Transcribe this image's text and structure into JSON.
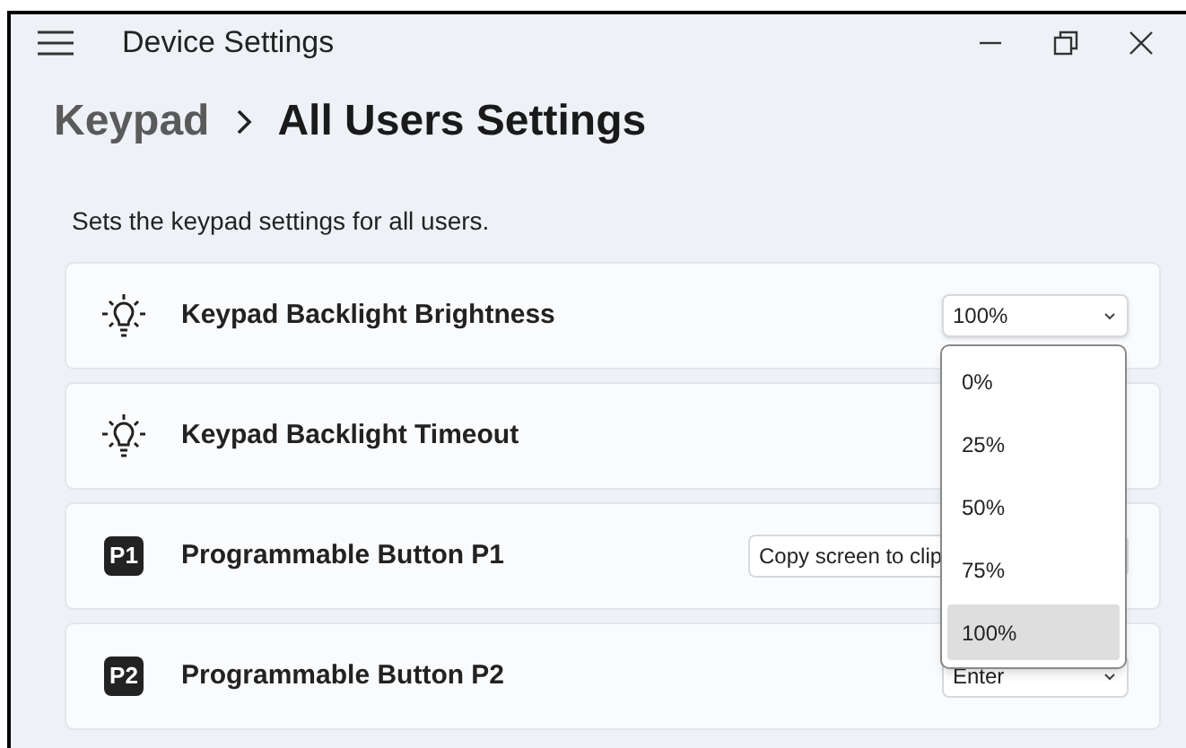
{
  "window": {
    "title": "Device Settings"
  },
  "breadcrumb": [
    {
      "label": "Keypad",
      "current": false
    },
    {
      "label": "All Users Settings",
      "current": true
    }
  ],
  "description": "Sets the keypad settings for all users.",
  "settings": [
    {
      "kind": "bulb",
      "label": "Keypad Backlight Brightness",
      "value": "100%",
      "open": true,
      "options": [
        {
          "label": "0%",
          "selected": false
        },
        {
          "label": "25%",
          "selected": false
        },
        {
          "label": "50%",
          "selected": false
        },
        {
          "label": "75%",
          "selected": false
        },
        {
          "label": "100%",
          "selected": true
        }
      ]
    },
    {
      "kind": "bulb",
      "label": "Keypad Backlight Timeout"
    },
    {
      "kind": "key",
      "badge": "P1",
      "label": "Programmable Button P1",
      "value": "Copy screen to clip",
      "open": false
    },
    {
      "kind": "key",
      "badge": "P2",
      "label": "Programmable Button P2",
      "value": "Enter",
      "open": false
    }
  ]
}
